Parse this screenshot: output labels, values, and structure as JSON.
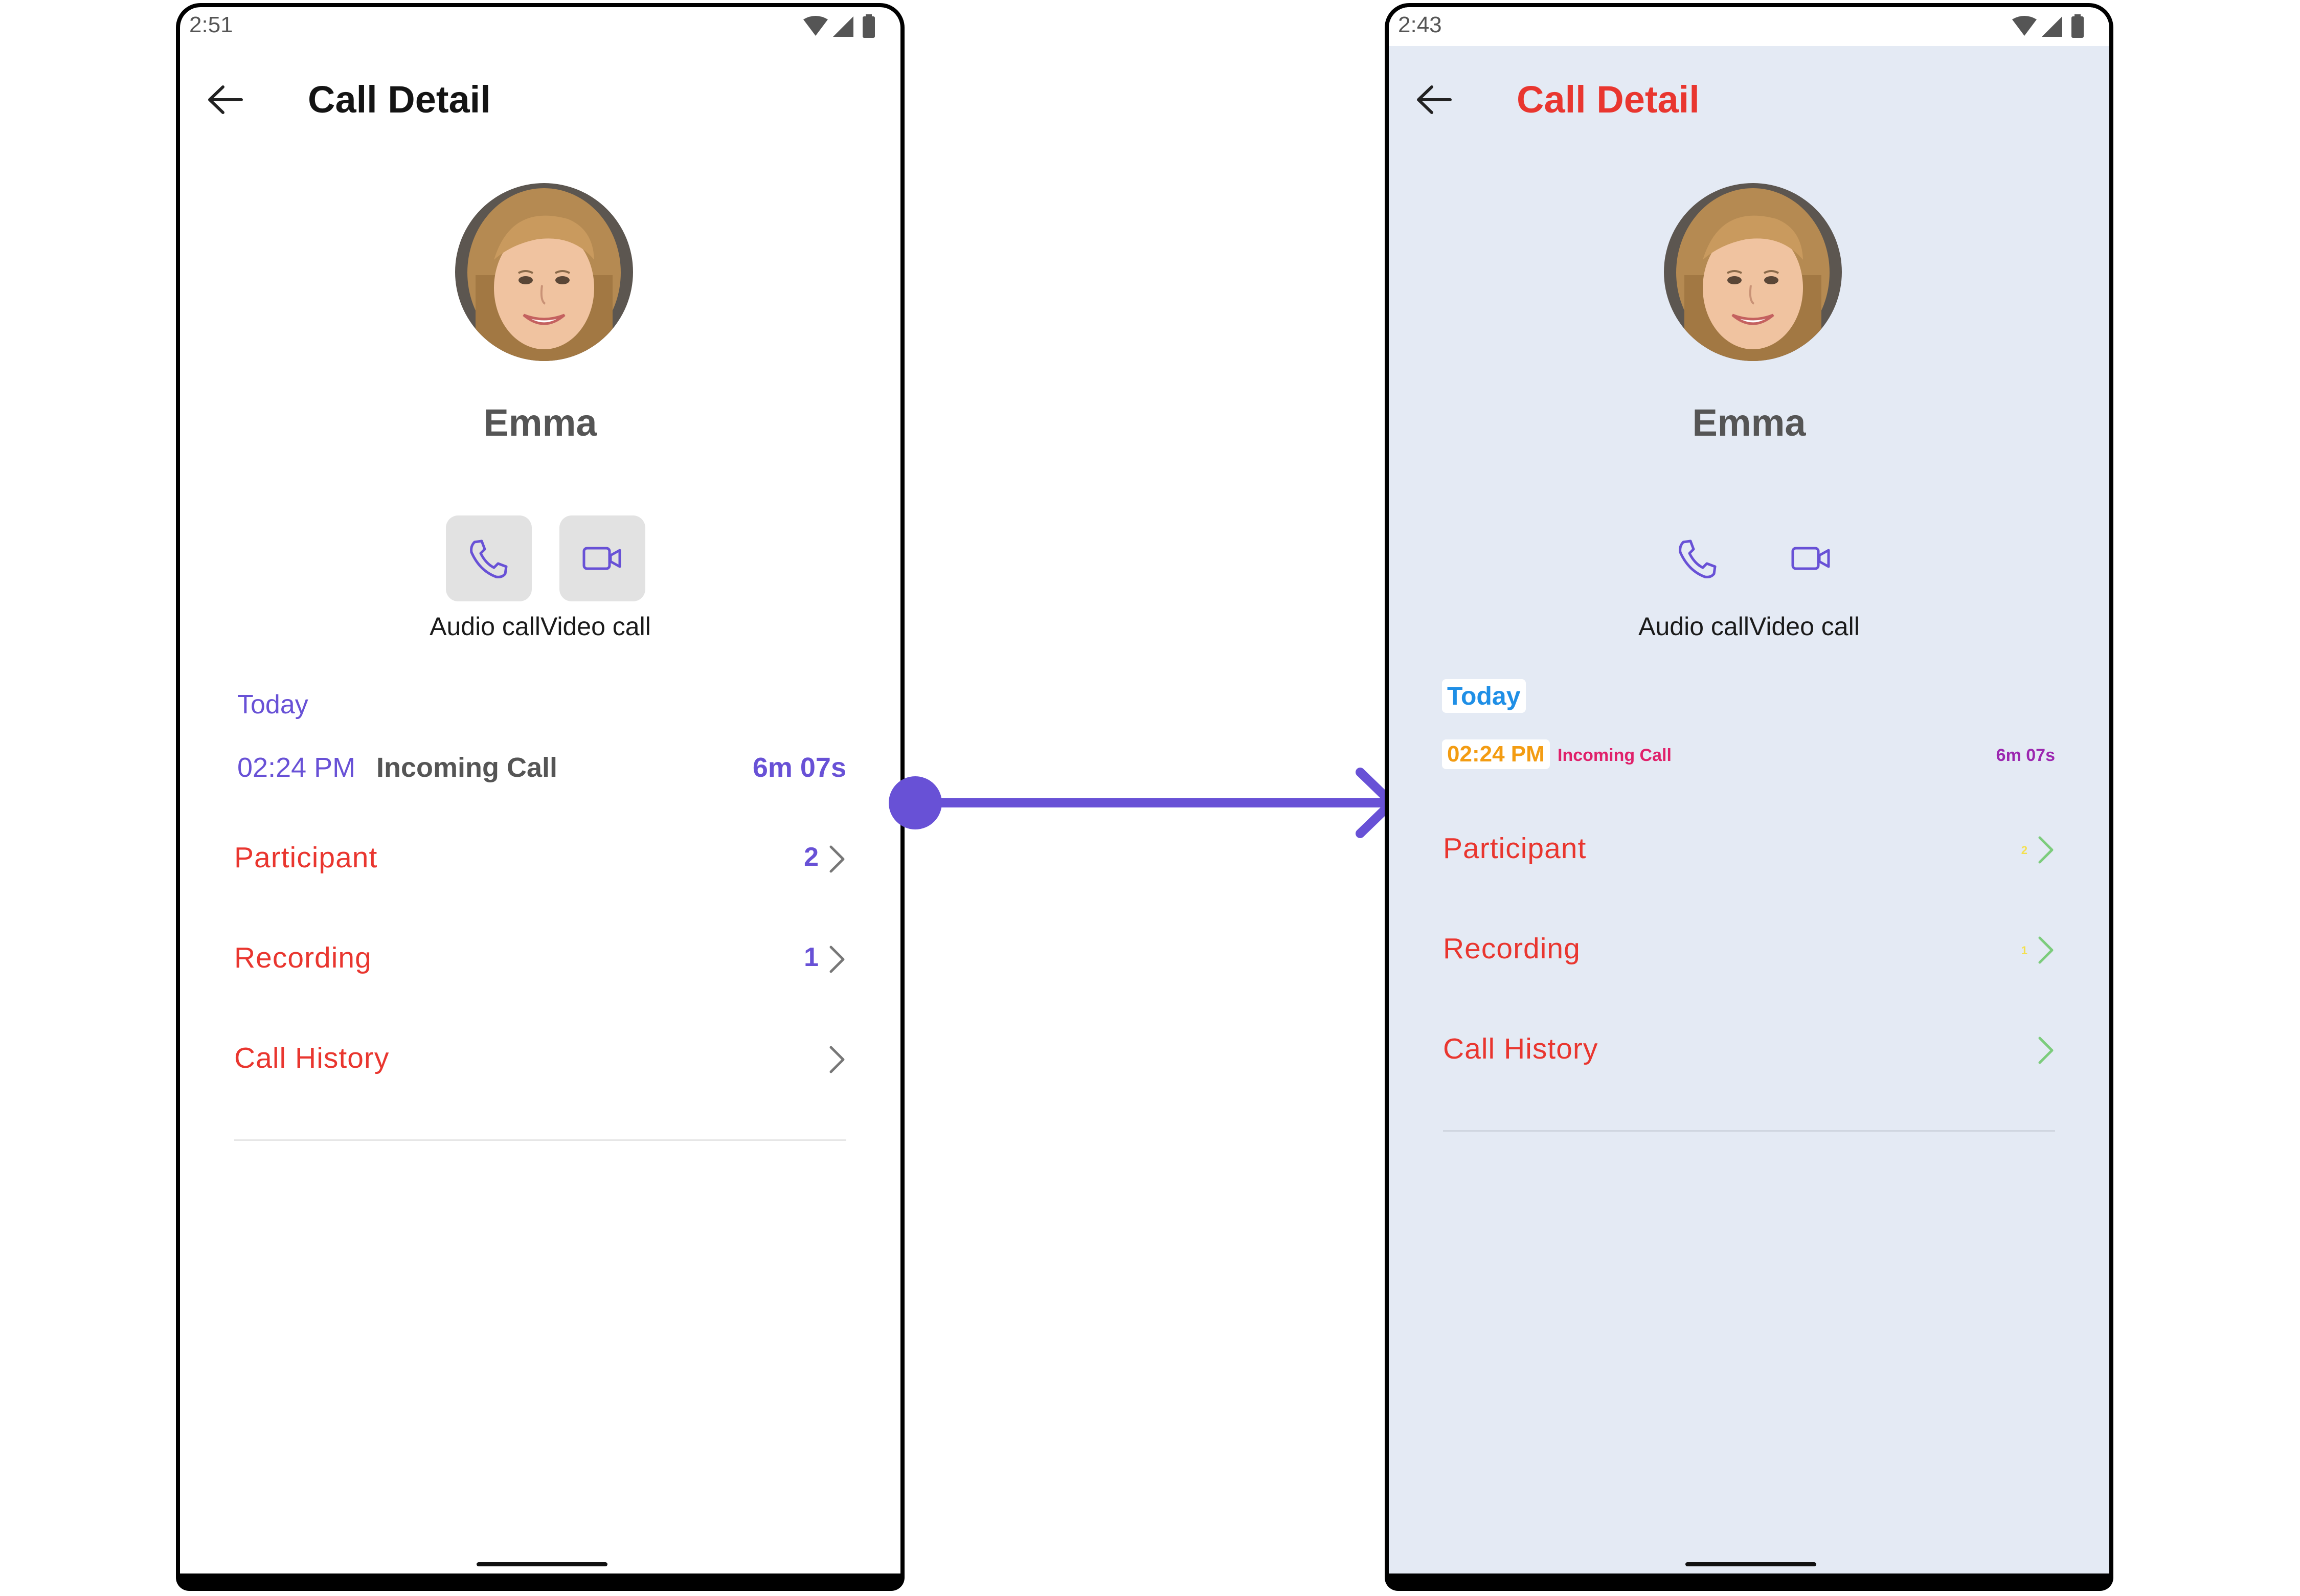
{
  "left": {
    "status_time": "2:51",
    "title": "Call Detail",
    "name": "Emma",
    "call_labels": "Audio callVideo call",
    "date_header": "Today",
    "call": {
      "time": "02:24 PM",
      "type": "Incoming Call",
      "duration": "6m 07s"
    },
    "options": [
      {
        "label": "Participant",
        "count": "2"
      },
      {
        "label": "Recording",
        "count": "1"
      },
      {
        "label": "Call History",
        "count": ""
      }
    ]
  },
  "right": {
    "status_time": "2:43",
    "title": "Call Detail",
    "name": "Emma",
    "call_labels": "Audio callVideo call",
    "date_header": "Today",
    "call": {
      "time": "02:24 PM",
      "type": "Incoming Call",
      "duration": "6m 07s"
    },
    "options": [
      {
        "label": "Participant",
        "count": "2"
      },
      {
        "label": "Recording",
        "count": "1"
      },
      {
        "label": "Call History",
        "count": ""
      }
    ]
  },
  "colors": {
    "accent": "#6851d6",
    "option_label": "#e9362f",
    "right_background": "#e4eaf4",
    "right_title": "#e9362f",
    "right_date": "#1f8fe6",
    "right_time": "#f39c12",
    "right_call_type": "#e0206a",
    "right_duration": "#9c27b0",
    "right_count": "#f4e04d",
    "right_chevron": "#7ccc7c"
  },
  "icons": [
    "back-arrow-icon",
    "audio-call-icon",
    "video-call-icon",
    "chevron-right-icon",
    "wifi-icon",
    "signal-icon",
    "battery-icon"
  ]
}
